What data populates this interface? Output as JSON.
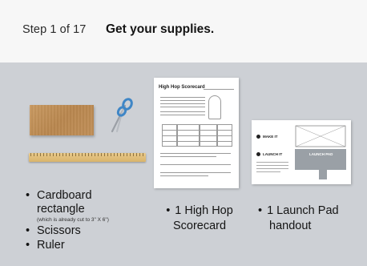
{
  "header": {
    "step_label": "Step 1 of 17",
    "title": "Get your supplies."
  },
  "supplies": {
    "items": [
      {
        "label_line1": "Cardboard",
        "label_line2": "rectangle",
        "note": "(which is already cut to 3\" X 6\")"
      },
      {
        "label": "Scissors"
      },
      {
        "label": "Ruler"
      }
    ]
  },
  "scorecard": {
    "sheet_title": "High Hop Scorecard",
    "caption_line1": "1 High Hop",
    "caption_line2": "Scorecard"
  },
  "launchpad": {
    "make_it_label": "MAKE IT",
    "launch_it_label": "LAUNCH IT",
    "launch_pad_label": "LAUNCH PAD",
    "caption_line1": "1 Launch Pad",
    "caption_line2": "handout"
  },
  "bullet_char": "•",
  "colors": {
    "header_bg": "#f7f7f7",
    "stage_bg": "#cdd0d5",
    "scissors_handle": "#3f86c6"
  },
  "icons": {
    "scissors": "scissors-icon",
    "cardboard": "cardboard-image",
    "ruler": "ruler-image"
  }
}
